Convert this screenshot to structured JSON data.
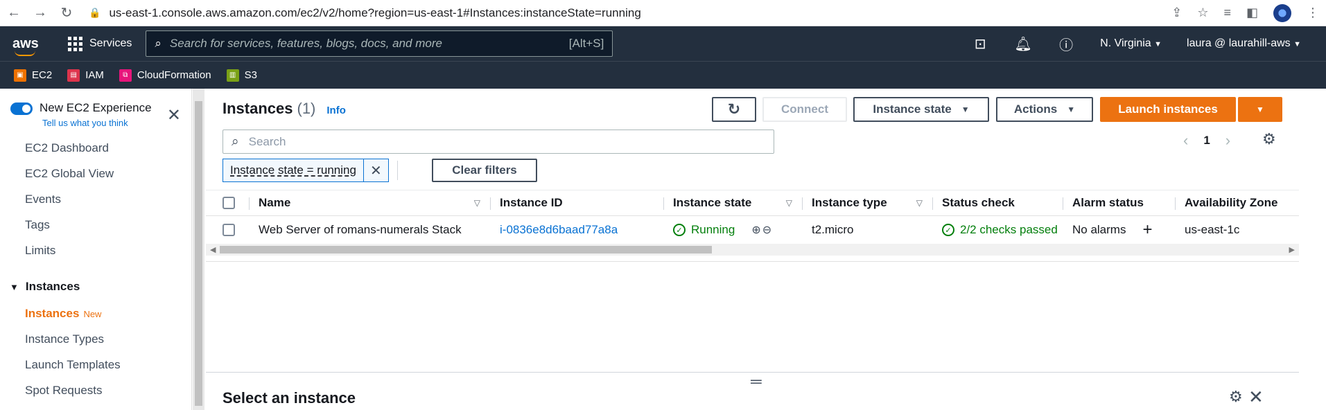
{
  "browser": {
    "url": "us-east-1.console.aws.amazon.com/ec2/v2/home?region=us-east-1#Instances:instanceState=running"
  },
  "topnav": {
    "logo": "aws",
    "services_label": "Services",
    "search_placeholder": "Search for services, features, blogs, docs, and more",
    "search_shortcut": "[Alt+S]",
    "region": "N. Virginia",
    "account": "laura @ laurahill-aws"
  },
  "favorites": [
    {
      "label": "EC2",
      "color": "#ed7100"
    },
    {
      "label": "IAM",
      "color": "#dd344c"
    },
    {
      "label": "CloudFormation",
      "color": "#e7157b"
    },
    {
      "label": "S3",
      "color": "#7aa116"
    }
  ],
  "sidebar": {
    "toggle_title": "New EC2 Experience",
    "toggle_subtitle": "Tell us what you think",
    "links_top": [
      "EC2 Dashboard",
      "EC2 Global View",
      "Events",
      "Tags",
      "Limits"
    ],
    "section": "Instances",
    "active_label": "Instances",
    "active_badge": "New",
    "links_bottom": [
      "Instance Types",
      "Launch Templates",
      "Spot Requests"
    ]
  },
  "instances": {
    "title": "Instances",
    "count": "(1)",
    "info": "Info",
    "connect": "Connect",
    "instance_state": "Instance state",
    "actions": "Actions",
    "launch": "Launch instances",
    "search_placeholder": "Search",
    "page": "1",
    "filter_token": "Instance state = running",
    "clear_filters": "Clear filters",
    "columns": [
      "Name",
      "Instance ID",
      "Instance state",
      "Instance type",
      "Status check",
      "Alarm status",
      "Availability Zone"
    ],
    "rows": [
      {
        "name": "Web Server of romans-numerals Stack",
        "id": "i-0836e8d6baad77a8a",
        "state": "Running",
        "type": "t2.micro",
        "status": "2/2 checks passed",
        "alarm": "No alarms",
        "az": "us-east-1c"
      }
    ]
  },
  "detail": {
    "title": "Select an instance"
  },
  "colors": {
    "orange": "#ec7211",
    "link": "#0972d3",
    "nav_bg": "#232f3e",
    "success": "#037f0c"
  }
}
